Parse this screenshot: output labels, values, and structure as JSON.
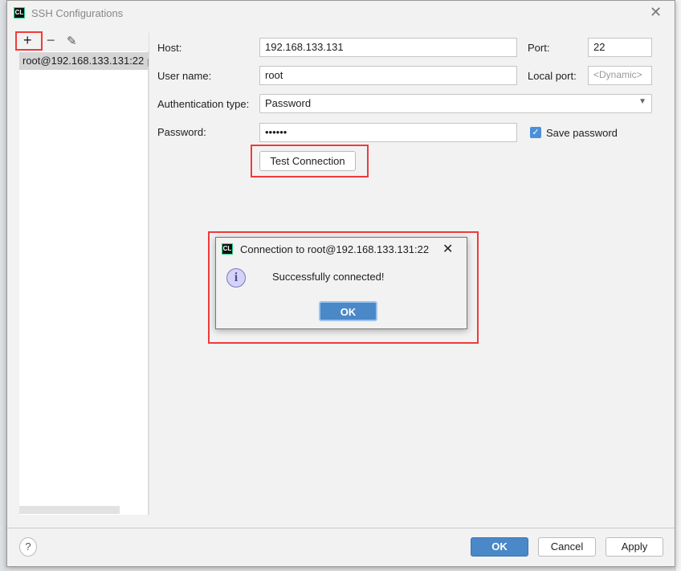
{
  "window": {
    "title": "SSH Configurations",
    "close_icon": "close-icon"
  },
  "toolbar": {
    "add": "+",
    "remove": "−",
    "edit_icon": "pencil-icon"
  },
  "list": {
    "items": [
      {
        "label": "root@192.168.133.131:22",
        "suffix": "p"
      }
    ]
  },
  "form": {
    "host_label": "Host:",
    "host_value": "192.168.133.131",
    "port_label": "Port:",
    "port_value": "22",
    "username_label": "User name:",
    "username_value": "root",
    "localport_label": "Local port:",
    "localport_placeholder": "<Dynamic>",
    "auth_label": "Authentication type:",
    "auth_value": "Password",
    "password_label": "Password:",
    "password_value": "••••••",
    "save_password_label": "Save password",
    "save_password_checked": true,
    "test_button": "Test Connection"
  },
  "popup": {
    "title": "Connection to root@192.168.133.131:22",
    "message": "Successfully connected!",
    "ok": "OK",
    "icon": "info-icon"
  },
  "footer": {
    "help": "?",
    "ok": "OK",
    "cancel": "Cancel",
    "apply": "Apply"
  },
  "colors": {
    "accent": "#4a88c7",
    "highlight": "#f03a3a"
  }
}
